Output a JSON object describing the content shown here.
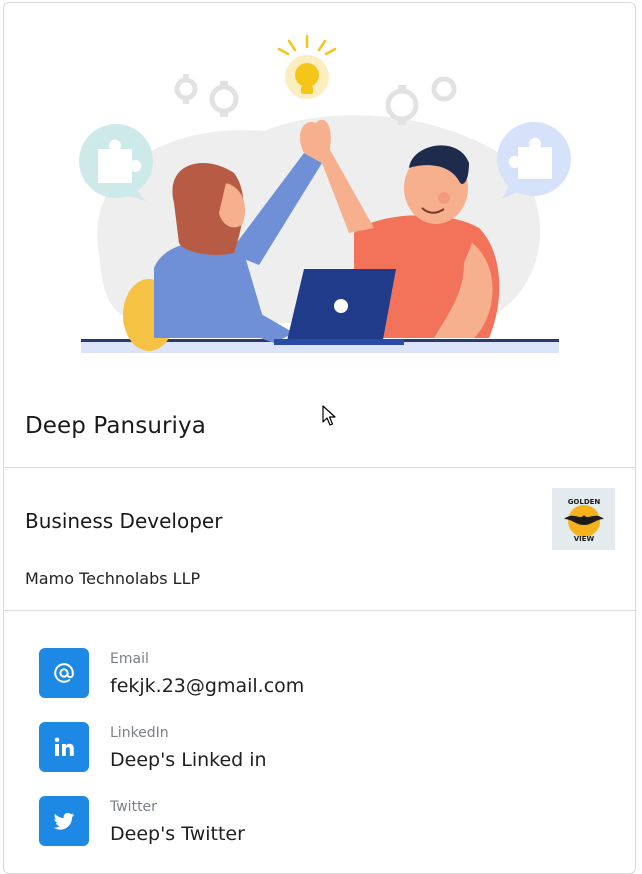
{
  "profile": {
    "name": "Deep Pansuriya",
    "role": "Business Developer",
    "company": "Mamo Technolabs LLP",
    "company_logo_text": [
      "GOLDEN",
      "VIEW"
    ]
  },
  "contacts": [
    {
      "label": "Email",
      "value": "fekjk.23@gmail.com",
      "icon": "at-icon"
    },
    {
      "label": "LinkedIn",
      "value": "Deep's Linked in",
      "icon": "linkedin-icon"
    },
    {
      "label": "Twitter",
      "value": "Deep's Twitter",
      "icon": "twitter-icon"
    }
  ],
  "colors": {
    "accent": "#1e88e5",
    "shirt": "#f2735a",
    "sweater": "#6f8fd6",
    "laptop": "#1f3b8a",
    "bulb": "#f5c518"
  }
}
